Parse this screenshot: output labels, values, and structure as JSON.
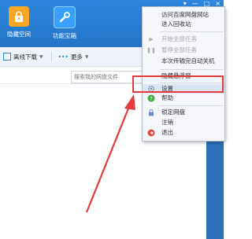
{
  "header": {
    "tiles": [
      {
        "label": "隐藏空间",
        "icon": "lock-icon"
      },
      {
        "label": "功能宝箱",
        "icon": "wrench-icon"
      }
    ],
    "controls": {
      "menu": "▾",
      "minimize": "—",
      "maximize": "□",
      "close": "×"
    }
  },
  "toolbar": {
    "offline_download": "离线下载",
    "more": "更多"
  },
  "search": {
    "placeholder": "搜索我的网盘文件"
  },
  "menu": {
    "items": [
      {
        "label": "访问百度网盘网站",
        "state": "enabled"
      },
      {
        "label": "进入回收站",
        "state": "enabled"
      },
      {
        "label": "开始全部任务",
        "state": "disabled",
        "icon": "play-icon"
      },
      {
        "label": "暂停全部任务",
        "state": "disabled",
        "icon": "pause-icon"
      },
      {
        "label": "本次传输完自动关机",
        "state": "enabled"
      },
      {
        "label": "隐藏悬浮窗",
        "state": "enabled"
      },
      {
        "label": "设置",
        "state": "hover",
        "icon": "gear-icon"
      },
      {
        "label": "帮助",
        "state": "enabled",
        "icon": "help-icon"
      },
      {
        "label": "锁定网盘",
        "state": "enabled",
        "icon": "lock-icon"
      },
      {
        "label": "注销",
        "state": "enabled"
      },
      {
        "label": "退出",
        "state": "enabled",
        "icon": "exit-icon"
      }
    ]
  },
  "colors": {
    "header_blue": "#2e86de",
    "annotation_red": "#e23b3b",
    "help_green": "#3fae3f",
    "exit_red": "#e04b3b"
  }
}
